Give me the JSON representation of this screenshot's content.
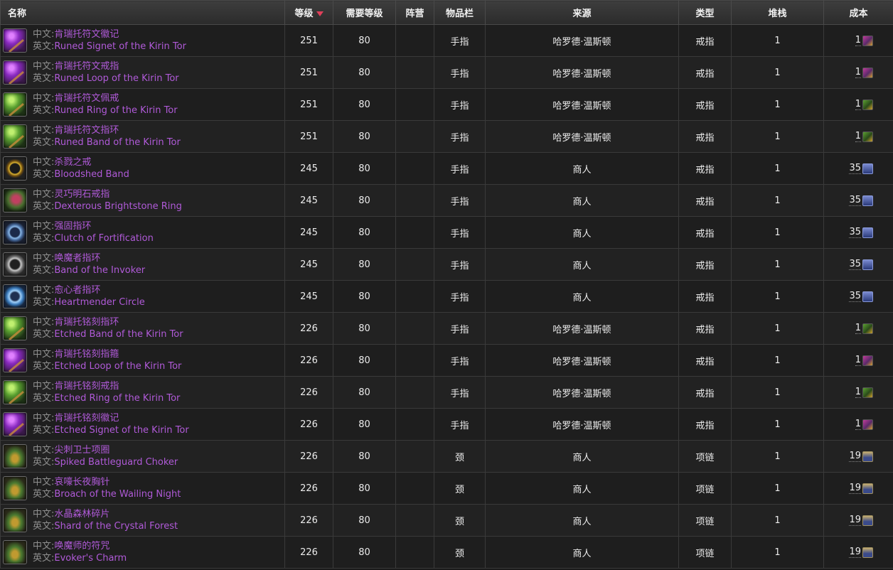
{
  "headers": {
    "name": "名称",
    "level": "等级",
    "req_level": "需要等级",
    "faction": "阵营",
    "slot": "物品栏",
    "source": "来源",
    "type": "类型",
    "stack": "堆栈",
    "cost": "成本"
  },
  "labels": {
    "cn": "中文:",
    "en": "英文:"
  },
  "rows": [
    {
      "cn": "肯瑞托符文徽记",
      "en": "Runed Signet of the Kirin Tor",
      "level": "251",
      "req": "80",
      "faction": "",
      "slot": "手指",
      "source": "哈罗德·温斯顿",
      "type": "戒指",
      "stack": "1",
      "cost": "1",
      "icon": "purple-ring-icon",
      "cost_icon": "purple"
    },
    {
      "cn": "肯瑞托符文戒指",
      "en": "Runed Loop of the Kirin Tor",
      "level": "251",
      "req": "80",
      "faction": "",
      "slot": "手指",
      "source": "哈罗德·温斯顿",
      "type": "戒指",
      "stack": "1",
      "cost": "1",
      "icon": "purple-ring-icon",
      "cost_icon": "purple"
    },
    {
      "cn": "肯瑞托符文佩戒",
      "en": "Runed Ring of the Kirin Tor",
      "level": "251",
      "req": "80",
      "faction": "",
      "slot": "手指",
      "source": "哈罗德·温斯顿",
      "type": "戒指",
      "stack": "1",
      "cost": "1",
      "icon": "green-ring-icon",
      "cost_icon": "green"
    },
    {
      "cn": "肯瑞托符文指环",
      "en": "Runed Band of the Kirin Tor",
      "level": "251",
      "req": "80",
      "faction": "",
      "slot": "手指",
      "source": "哈罗德·温斯顿",
      "type": "戒指",
      "stack": "1",
      "cost": "1",
      "icon": "green-ring-icon",
      "cost_icon": "green"
    },
    {
      "cn": "杀戮之戒",
      "en": "Bloodshed Band",
      "level": "245",
      "req": "80",
      "faction": "",
      "slot": "手指",
      "source": "商人",
      "type": "戒指",
      "stack": "1",
      "cost": "35",
      "icon": "gold-ring-icon",
      "cost_icon": "emblem"
    },
    {
      "cn": "灵巧明石戒指",
      "en": "Dexterous Brightstone Ring",
      "level": "245",
      "req": "80",
      "faction": "",
      "slot": "手指",
      "source": "商人",
      "type": "戒指",
      "stack": "1",
      "cost": "35",
      "icon": "gem-ring-icon",
      "cost_icon": "emblem"
    },
    {
      "cn": "强固指环",
      "en": "Clutch of Fortification",
      "level": "245",
      "req": "80",
      "faction": "",
      "slot": "手指",
      "source": "商人",
      "type": "戒指",
      "stack": "1",
      "cost": "35",
      "icon": "blue-ring-icon",
      "cost_icon": "emblem"
    },
    {
      "cn": "唤魔者指环",
      "en": "Band of the Invoker",
      "level": "245",
      "req": "80",
      "faction": "",
      "slot": "手指",
      "source": "商人",
      "type": "戒指",
      "stack": "1",
      "cost": "35",
      "icon": "silver-ring-icon",
      "cost_icon": "emblem"
    },
    {
      "cn": "愈心者指环",
      "en": "Heartmender Circle",
      "level": "245",
      "req": "80",
      "faction": "",
      "slot": "手指",
      "source": "商人",
      "type": "戒指",
      "stack": "1",
      "cost": "35",
      "icon": "ice-ring-icon",
      "cost_icon": "emblem"
    },
    {
      "cn": "肯瑞托铭刻指环",
      "en": "Etched Band of the Kirin Tor",
      "level": "226",
      "req": "80",
      "faction": "",
      "slot": "手指",
      "source": "哈罗德·温斯顿",
      "type": "戒指",
      "stack": "1",
      "cost": "1",
      "icon": "green-ring-icon",
      "cost_icon": "green"
    },
    {
      "cn": "肯瑞托铭刻指箍",
      "en": "Etched Loop of the Kirin Tor",
      "level": "226",
      "req": "80",
      "faction": "",
      "slot": "手指",
      "source": "哈罗德·温斯顿",
      "type": "戒指",
      "stack": "1",
      "cost": "1",
      "icon": "purple-ring-icon",
      "cost_icon": "purple"
    },
    {
      "cn": "肯瑞托铭刻戒指",
      "en": "Etched Ring of the Kirin Tor",
      "level": "226",
      "req": "80",
      "faction": "",
      "slot": "手指",
      "source": "哈罗德·温斯顿",
      "type": "戒指",
      "stack": "1",
      "cost": "1",
      "icon": "green-ring-icon",
      "cost_icon": "green"
    },
    {
      "cn": "肯瑞托铭刻徽记",
      "en": "Etched Signet of the Kirin Tor",
      "level": "226",
      "req": "80",
      "faction": "",
      "slot": "手指",
      "source": "哈罗德·温斯顿",
      "type": "戒指",
      "stack": "1",
      "cost": "1",
      "icon": "purple-ring-icon",
      "cost_icon": "purple"
    },
    {
      "cn": "尖刺卫士项圈",
      "en": "Spiked Battleguard Choker",
      "level": "226",
      "req": "80",
      "faction": "",
      "slot": "颈",
      "source": "商人",
      "type": "项链",
      "stack": "1",
      "cost": "19",
      "icon": "necklace-icon",
      "cost_icon": "stone"
    },
    {
      "cn": "哀嚎长夜胸针",
      "en": "Broach of the Wailing Night",
      "level": "226",
      "req": "80",
      "faction": "",
      "slot": "颈",
      "source": "商人",
      "type": "项链",
      "stack": "1",
      "cost": "19",
      "icon": "necklace-icon",
      "cost_icon": "stone"
    },
    {
      "cn": "水晶森林碎片",
      "en": "Shard of the Crystal Forest",
      "level": "226",
      "req": "80",
      "faction": "",
      "slot": "颈",
      "source": "商人",
      "type": "项链",
      "stack": "1",
      "cost": "19",
      "icon": "necklace-icon",
      "cost_icon": "stone"
    },
    {
      "cn": "唤魔师的符咒",
      "en": "Evoker's Charm",
      "level": "226",
      "req": "80",
      "faction": "",
      "slot": "颈",
      "source": "商人",
      "type": "项链",
      "stack": "1",
      "cost": "19",
      "icon": "necklace-icon",
      "cost_icon": "stone"
    }
  ]
}
